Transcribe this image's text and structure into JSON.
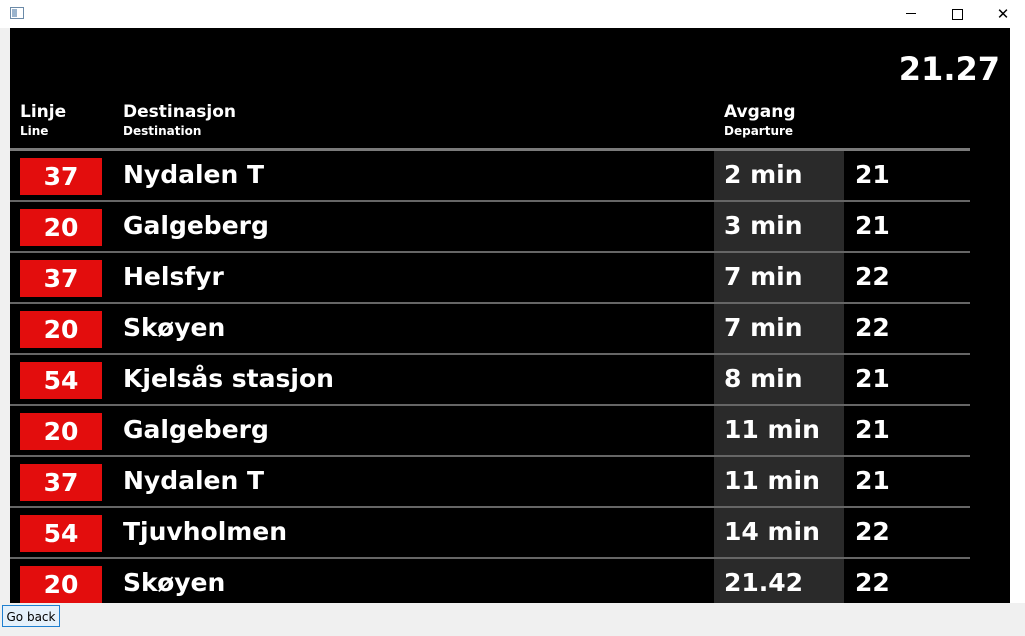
{
  "window": {
    "minimize_icon": "minimize-icon",
    "maximize_icon": "maximize-icon",
    "close_glyph": "✕"
  },
  "board": {
    "clock": "21.27",
    "headers": {
      "line_main": "Linje",
      "line_sub": "Line",
      "destination_main": "Destinasjon",
      "destination_sub": "Destination",
      "departure_main": "Avgang",
      "departure_sub": "Departure"
    },
    "colors": {
      "background": "#000000",
      "line_badge": "#e30d0d",
      "departure_cell": "#2a2a2a",
      "text": "#ffffff"
    },
    "rows": [
      {
        "line": "37",
        "destination": "Nydalen T",
        "departure": "2 min",
        "platform": "21"
      },
      {
        "line": "20",
        "destination": "Galgeberg",
        "departure": "3 min",
        "platform": "21"
      },
      {
        "line": "37",
        "destination": "Helsfyr",
        "departure": "7 min",
        "platform": "22"
      },
      {
        "line": "20",
        "destination": "Skøyen",
        "departure": "7 min",
        "platform": "22"
      },
      {
        "line": "54",
        "destination": "Kjelsås stasjon",
        "departure": "8 min",
        "platform": "21"
      },
      {
        "line": "20",
        "destination": "Galgeberg",
        "departure": "11 min",
        "platform": "21"
      },
      {
        "line": "37",
        "destination": "Nydalen T",
        "departure": "11 min",
        "platform": "21"
      },
      {
        "line": "54",
        "destination": "Tjuvholmen",
        "departure": "14 min",
        "platform": "22"
      },
      {
        "line": "20",
        "destination": "Skøyen",
        "departure": "21.42",
        "platform": "22"
      }
    ]
  },
  "footer": {
    "go_back_label": "Go back"
  }
}
